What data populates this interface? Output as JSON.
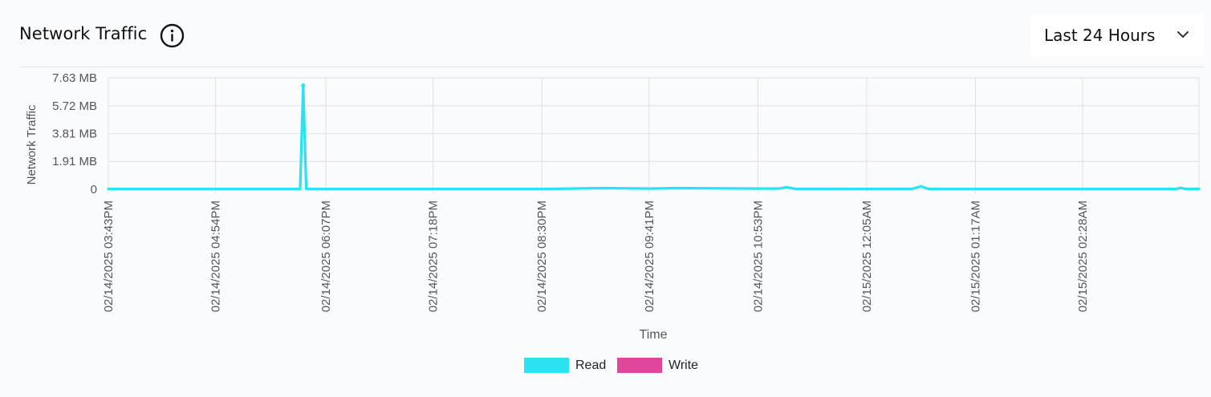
{
  "header": {
    "title": "Network Traffic",
    "range_label": "Last 24 Hours"
  },
  "icons": {
    "info": "info-circle-icon",
    "dropdown": "chevron-down-icon"
  },
  "colors": {
    "read": "#29e3f0",
    "write": "#e0479a",
    "grid": "#e0e0e0",
    "axis_text": "#555555"
  },
  "chart_data": {
    "type": "line",
    "title": "",
    "xlabel": "Time",
    "ylabel": "Network Traffic",
    "y_ticks": [
      "0",
      "1.91 MB",
      "3.81 MB",
      "5.72 MB",
      "7.63 MB"
    ],
    "y_tick_values_mb": [
      0,
      1.91,
      3.81,
      5.72,
      7.63
    ],
    "ylim_mb": [
      0,
      7.63
    ],
    "x_ticks": [
      "02/14/2025 03:43PM",
      "02/14/2025 04:54PM",
      "02/14/2025 06:07PM",
      "02/14/2025 07:18PM",
      "02/14/2025 08:30PM",
      "02/14/2025 09:41PM",
      "02/14/2025 10:53PM",
      "02/15/2025 12:05AM",
      "02/15/2025 01:17AM",
      "02/15/2025 02:28AM"
    ],
    "x_end": "02/15/2025 03:45AM",
    "grid": true,
    "legend_position": "bottom-center",
    "series": [
      {
        "name": "Read",
        "color": "#29e3f0",
        "points": [
          [
            "02/14/2025 03:43PM",
            0.02
          ],
          [
            "02/14/2025 04:54PM",
            0.02
          ],
          [
            "02/14/2025 05:50PM",
            0.02
          ],
          [
            "02/14/2025 05:52PM",
            7.1
          ],
          [
            "02/14/2025 05:54PM",
            0.02
          ],
          [
            "02/14/2025 07:18PM",
            0.02
          ],
          [
            "02/14/2025 08:30PM",
            0.02
          ],
          [
            "02/14/2025 08:50PM",
            0.05
          ],
          [
            "02/14/2025 09:10PM",
            0.08
          ],
          [
            "02/14/2025 09:41PM",
            0.05
          ],
          [
            "02/14/2025 10:00PM",
            0.08
          ],
          [
            "02/14/2025 10:30PM",
            0.06
          ],
          [
            "02/14/2025 10:53PM",
            0.05
          ],
          [
            "02/14/2025 11:07PM",
            0.05
          ],
          [
            "02/14/2025 11:12PM",
            0.14
          ],
          [
            "02/14/2025 11:18PM",
            0.03
          ],
          [
            "02/15/2025 12:05AM",
            0.02
          ],
          [
            "02/15/2025 12:35AM",
            0.03
          ],
          [
            "02/15/2025 12:41AM",
            0.2
          ],
          [
            "02/15/2025 12:46AM",
            0.02
          ],
          [
            "02/15/2025 01:17AM",
            0.02
          ],
          [
            "02/15/2025 02:28AM",
            0.02
          ],
          [
            "02/15/2025 03:30AM",
            0.02
          ],
          [
            "02/15/2025 03:33AM",
            0.1
          ],
          [
            "02/15/2025 03:36AM",
            0.02
          ],
          [
            "02/15/2025 03:45AM",
            0.03
          ]
        ]
      },
      {
        "name": "Write",
        "color": "#e0479a",
        "points": []
      }
    ]
  },
  "legend": {
    "read_label": "Read",
    "write_label": "Write"
  }
}
